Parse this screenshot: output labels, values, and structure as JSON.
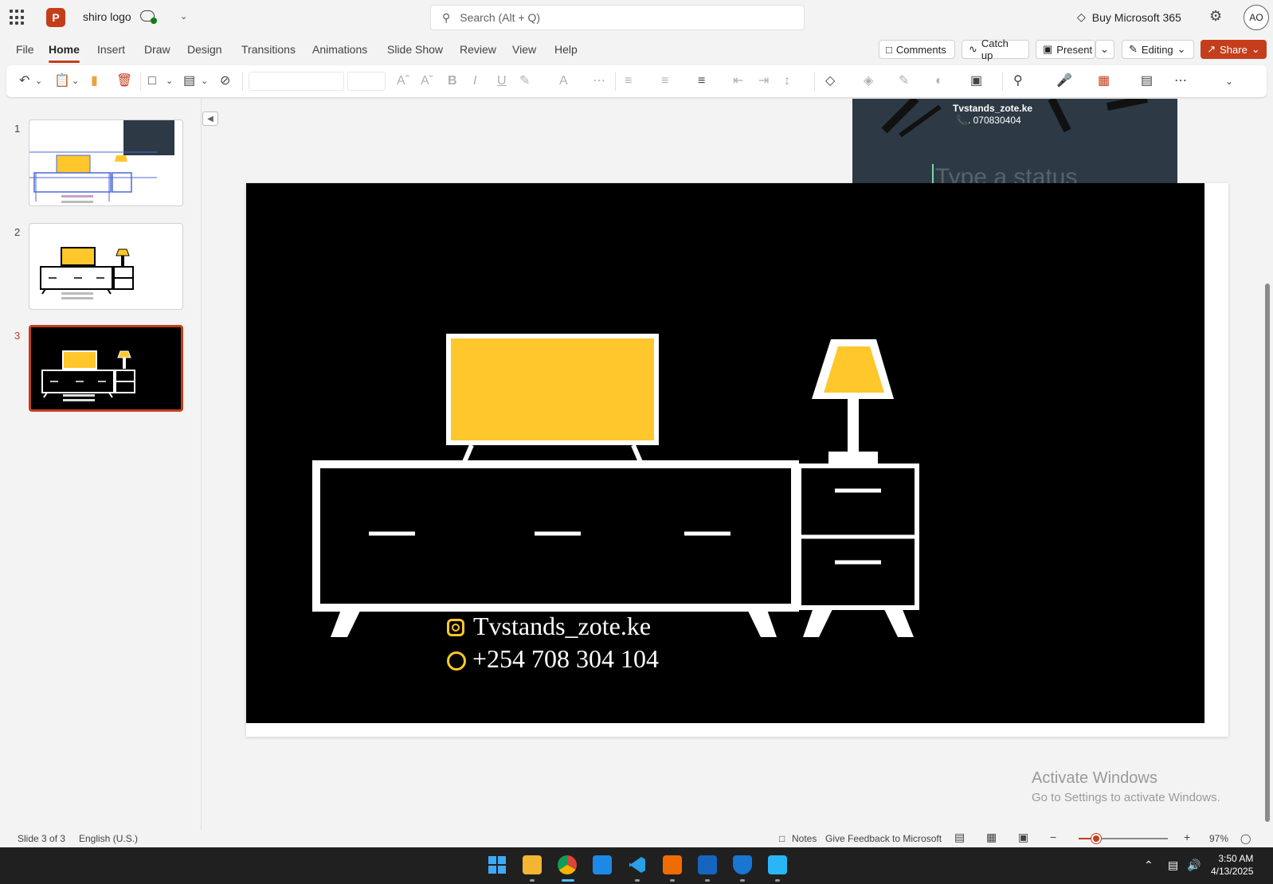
{
  "titlebar": {
    "app_logo": "P",
    "doc_title": "shiro logo",
    "search_placeholder": "Search (Alt + Q)",
    "buy_label": "Buy Microsoft 365",
    "avatar_initials": "AO"
  },
  "tabs": [
    "File",
    "Home",
    "Insert",
    "Draw",
    "Design",
    "Transitions",
    "Animations",
    "Slide Show",
    "Review",
    "View",
    "Help"
  ],
  "active_tab": "Home",
  "ribbon_buttons": {
    "comments": "Comments",
    "catch_up": "Catch up",
    "present": "Present",
    "editing": "Editing",
    "share": "Share"
  },
  "thumbnails": [
    {
      "number": "1",
      "selected": false
    },
    {
      "number": "2",
      "selected": false
    },
    {
      "number": "3",
      "selected": true
    }
  ],
  "overlay_image": {
    "line1": "Tvstands_zote.ke",
    "line2": "📞. 070830404",
    "line3": "Type a status"
  },
  "slide": {
    "background": "#000000",
    "accent": "#FFC72C",
    "instagram_text": "Tvstands_zote.ke",
    "whatsapp_text": "+254 708 304 104"
  },
  "watermark": {
    "line1": "Activate Windows",
    "line2": "Go to Settings to activate Windows."
  },
  "statusbar": {
    "slide_info": "Slide 3 of 3",
    "language": "English (U.S.)",
    "notes": "Notes",
    "feedback": "Give Feedback to Microsoft",
    "zoom": "97%"
  },
  "clock": {
    "time": "3:50 AM",
    "date": "4/13/2025"
  },
  "colors": {
    "brand": "#c43e1c",
    "taskbar": "#202020"
  }
}
